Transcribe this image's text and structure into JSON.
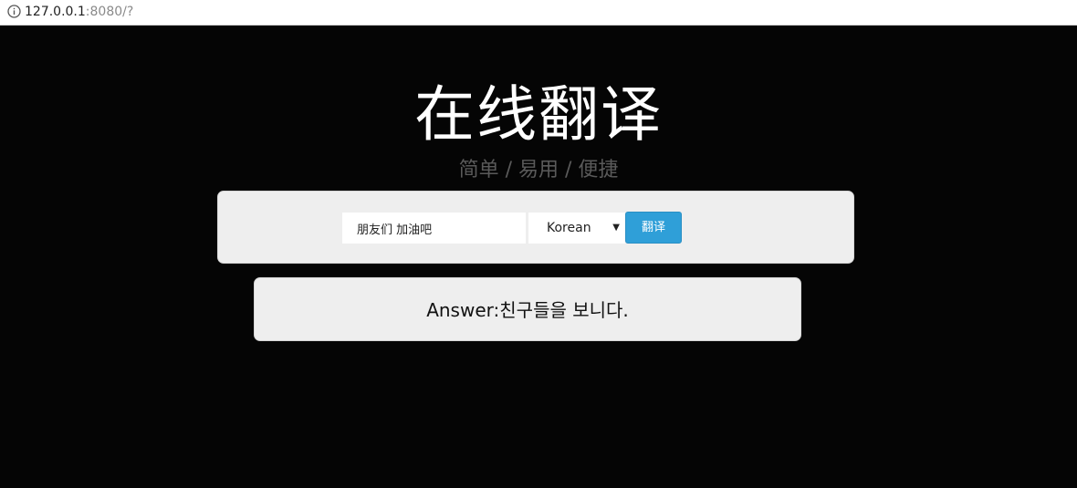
{
  "browser": {
    "url_host": "127.0.0.1",
    "url_rest": ":8080/?"
  },
  "header": {
    "title": "在线翻译",
    "subtitle": "简单 / 易用 / 便捷"
  },
  "form": {
    "input_value": "朋友们 加油吧",
    "language_selected": "Korean",
    "select_arrow": "▼",
    "translate_label": "翻译"
  },
  "answer": {
    "label": "Answer:",
    "text": "친구들을 보니다."
  },
  "colors": {
    "background": "#050505",
    "panel": "#eeeeee",
    "button": "#2f9fd8",
    "subtitle": "#5a5a5a"
  }
}
